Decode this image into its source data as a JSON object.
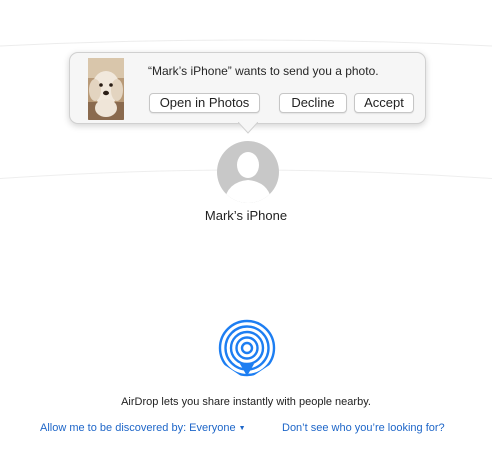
{
  "window": {
    "background": "#ffffff"
  },
  "notification": {
    "message": "“Mark’s iPhone” wants to send you a photo.",
    "thumbnail_icon": "photo-thumbnail-dog",
    "buttons": {
      "open_label": "Open in Photos",
      "decline_label": "Decline",
      "accept_label": "Accept"
    }
  },
  "device": {
    "name": "Mark’s iPhone",
    "avatar_icon": "person-silhouette-icon"
  },
  "airdrop": {
    "icon": "airdrop-icon",
    "accent_color": "#1d7ef2",
    "description": "AirDrop lets you share instantly with people nearby.",
    "discover_label": "Allow me to be discovered by: Everyone",
    "help_link": "Don’t see who you’re looking for?"
  }
}
